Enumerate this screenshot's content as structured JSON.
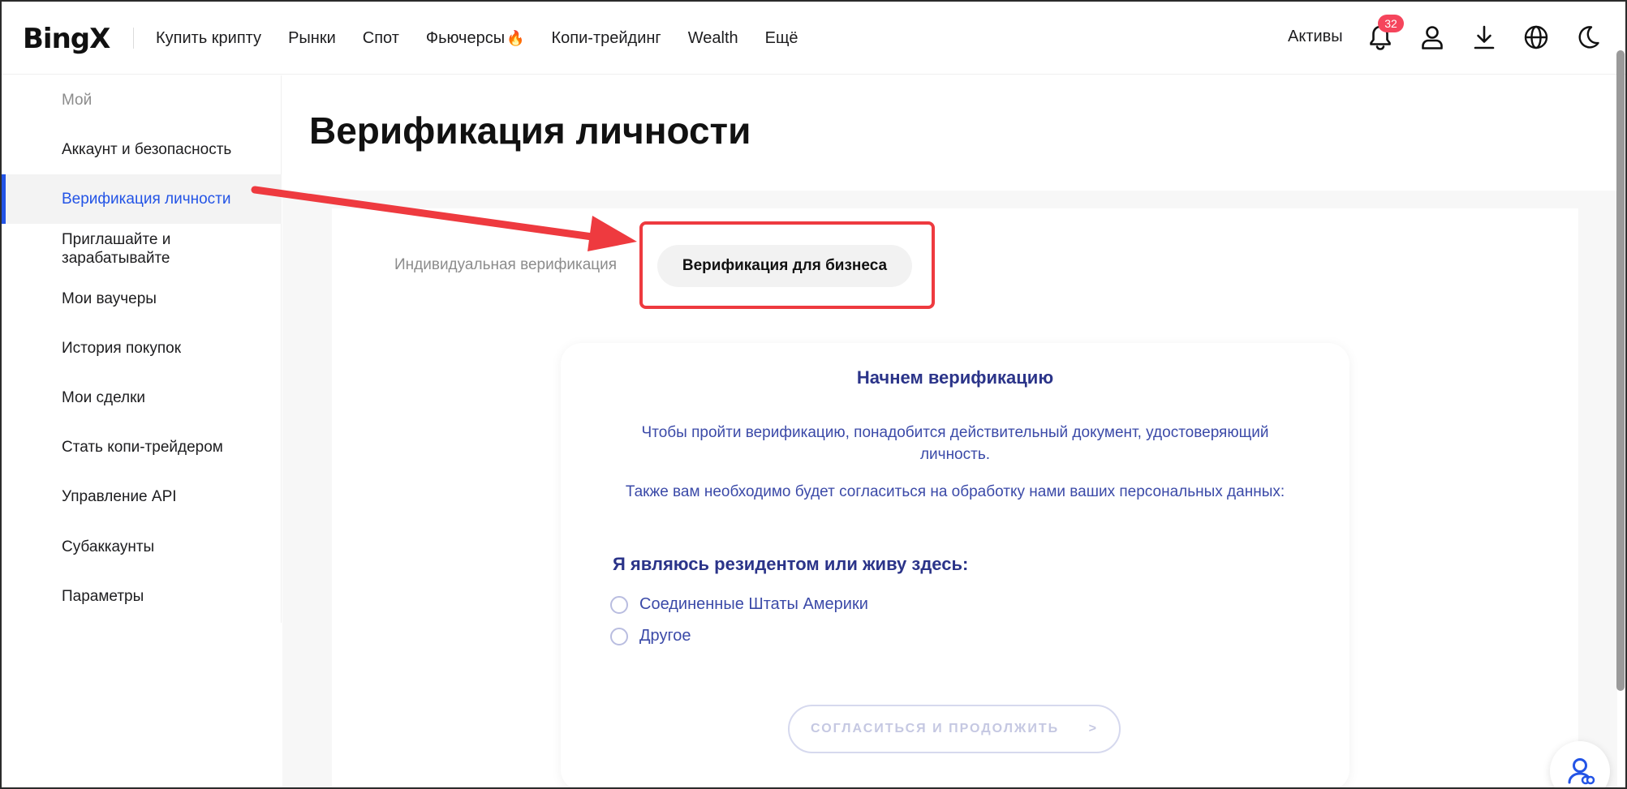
{
  "header": {
    "logo": "BingX",
    "nav": [
      "Купить крипту",
      "Рынки",
      "Спот",
      "Фьючерсы",
      "Копи-трейдинг",
      "Wealth",
      "Ещё"
    ],
    "futures_icon": "fire-emoji",
    "assets_label": "Активы",
    "notification_count": "32",
    "icons": [
      "bell-icon",
      "user-icon",
      "download-icon",
      "globe-icon",
      "moon-icon"
    ]
  },
  "sidebar": {
    "heading": "Мой",
    "items": [
      {
        "label": "Аккаунт и безопасность"
      },
      {
        "label": "Верификация личности"
      },
      {
        "label": "Приглашайте и зарабатывайте"
      },
      {
        "label": "Мои ваучеры"
      },
      {
        "label": "История покупок"
      },
      {
        "label": "Мои сделки"
      },
      {
        "label": "Стать копи-трейдером"
      },
      {
        "label": "Управление API"
      },
      {
        "label": "Субаккаунты"
      },
      {
        "label": "Параметры"
      }
    ],
    "active_index": 1
  },
  "main": {
    "title": "Верификация личности",
    "tabs": [
      {
        "label": "Индивидуальная верификация"
      },
      {
        "label": "Верификация для бизнеса"
      }
    ],
    "card": {
      "title": "Начнем верификацию",
      "text1": "Чтобы пройти верификацию, понадобится действительный документ, удостоверяющий личность.",
      "text2": "Также вам необходимо будет согласиться на обработку нами ваших персональных данных:",
      "question": "Я являюсь резидентом или живу здесь:",
      "options": [
        "Соединенные Штаты Америки",
        "Другое"
      ],
      "button_label": "СОГЛАСИТЬСЯ И ПРОДОЛЖИТЬ",
      "button_arrow": ">"
    }
  },
  "colors": {
    "accent": "#2354e6",
    "annotation": "#ee3a3f",
    "card_text": "#3b4aa8",
    "badge": "#f5455c"
  }
}
